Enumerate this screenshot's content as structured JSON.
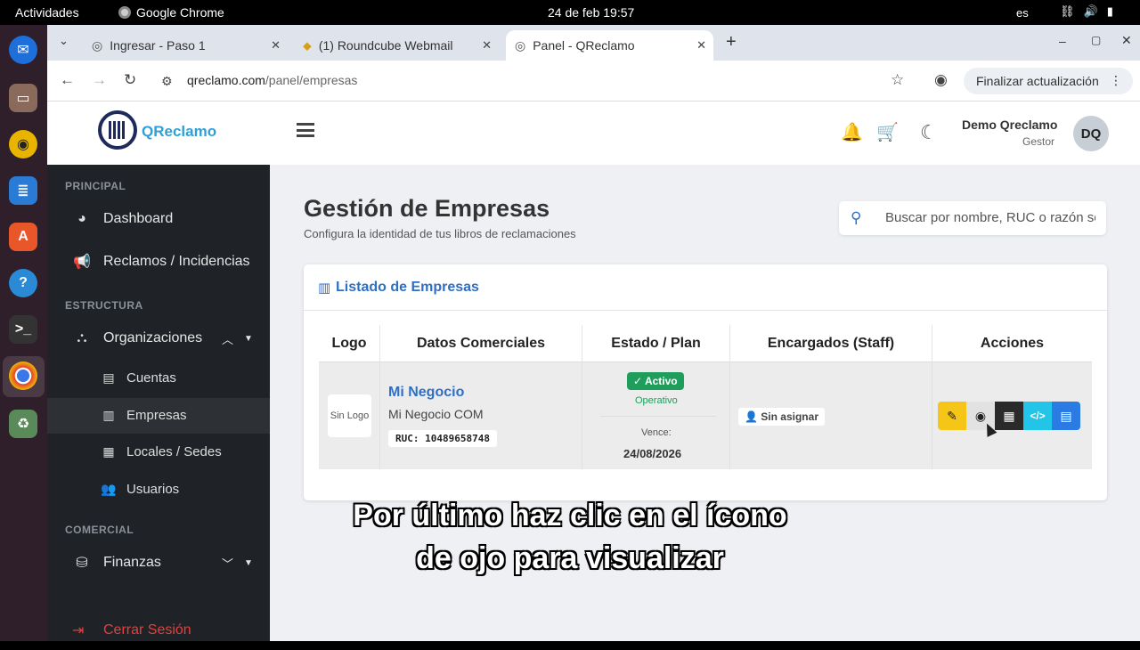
{
  "os": {
    "activities": "Actividades",
    "app_name": "Google Chrome",
    "clock": "24 de feb  19:57",
    "lang": "es"
  },
  "browser": {
    "tabs": [
      {
        "label": "Ingresar - Paso 1"
      },
      {
        "label": "(1) Roundcube Webmail"
      },
      {
        "label": "Panel - QReclamo"
      }
    ],
    "new_tab": "+",
    "url_host": "qreclamo.com",
    "url_path": "/panel/empresas",
    "update_button": "Finalizar actualización"
  },
  "header": {
    "brand_q": "QR",
    "brand_rest": "eclamo",
    "user_name": "Demo Qreclamo",
    "user_role": "Gestor",
    "avatar_initials": "DQ"
  },
  "sidebar": {
    "section_principal": "PRINCIPAL",
    "dashboard": "Dashboard",
    "reclamos": "Reclamos / Incidencias",
    "section_estructura": "ESTRUCTURA",
    "organizaciones": "Organizaciones",
    "cuentas": "Cuentas",
    "empresas": "Empresas",
    "locales": "Locales / Sedes",
    "usuarios": "Usuarios",
    "section_comercial": "COMERCIAL",
    "finanzas": "Finanzas",
    "logout": "Cerrar Sesión"
  },
  "main": {
    "title": "Gestión de Empresas",
    "subtitle": "Configura la identidad de tus libros de reclamaciones",
    "search_placeholder": "Buscar por nombre, RUC o razón social",
    "card_title": "Listado de Empresas",
    "columns": [
      "Logo",
      "Datos Comerciales",
      "Estado / Plan",
      "Encargados (Staff)",
      "Acciones"
    ],
    "row": {
      "logo": "Sin Logo",
      "name": "Mi Negocio",
      "legal_name": "Mi Negocio COM",
      "ruc": "RUC: 10489658748",
      "status": "Activo",
      "status_sub": "Operativo",
      "expires_label": "Vence:",
      "expires_date": "24/08/2026",
      "staff": "Sin asignar"
    }
  },
  "caption": {
    "line1": "Por último haz clic en el ícono",
    "line2": "de ojo para visualizar"
  },
  "colors": {
    "accent": "#2f6fc4",
    "sidebar_bg": "#1f2226",
    "success": "#1e9e5a",
    "edit_btn": "#f5c518",
    "code_btn": "#22c4e8"
  }
}
